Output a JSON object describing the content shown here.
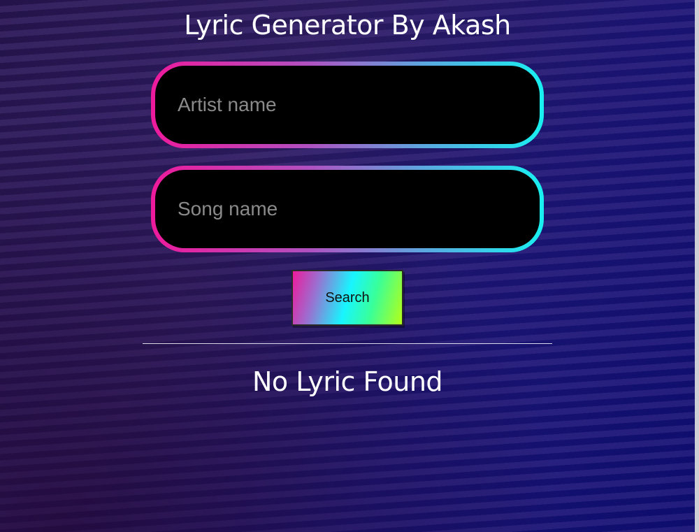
{
  "header": {
    "title": "Lyric Generator By Akash"
  },
  "form": {
    "artist_placeholder": "Artist name",
    "artist_value": "",
    "song_placeholder": "Song name",
    "song_value": "",
    "search_label": "Search"
  },
  "result": {
    "message": "No Lyric Found"
  },
  "colors": {
    "field_gradient_start": "#ee1a9c",
    "field_gradient_end": "#18f0f0",
    "button_gradient": [
      "#ee1a9c",
      "#18f5ff",
      "#b4ff18"
    ],
    "background": "#24134a"
  }
}
